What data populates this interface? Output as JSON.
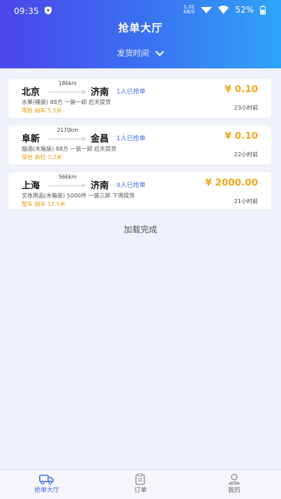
{
  "status_bar": {
    "time": "09:35",
    "net_speed_value": "1.02",
    "net_speed_unit": "KB/S",
    "battery": "52%"
  },
  "header": {
    "title": "抢单大厅",
    "filter_label": "发货时间"
  },
  "orders": [
    {
      "from": "北京",
      "to": "济南",
      "distance": "186km",
      "grabbed": "1人已抢单",
      "price": "¥ 0.10",
      "goods": "水果(桶装) 88方 一装一卸 后天提货",
      "vehicle": "零担 厢车 5.5米",
      "time_ago": "23小时前"
    },
    {
      "from": "阜新",
      "to": "金昌",
      "distance": "2170km",
      "grabbed": "1人已抢单",
      "price": "¥ 0.10",
      "goods": "烟酒(木箱装) 88方 一装一卸 后天提货",
      "vehicle": "零担 高栏 7.2米",
      "time_ago": "22小时前"
    },
    {
      "from": "上海",
      "to": "济南",
      "distance": "566km",
      "grabbed": "0人已抢单",
      "price": "¥ 2000.00",
      "goods": "文体用品(木箱装) 5000件 一装三卸 下周提货",
      "vehicle": "整车 厢车 17.5米",
      "time_ago": "21小时前"
    }
  ],
  "load_status": "加载完成",
  "tabs": [
    {
      "label": "抢单大厅",
      "icon": "truck-icon",
      "active": true
    },
    {
      "label": "订单",
      "icon": "clipboard-icon",
      "active": false
    },
    {
      "label": "我的",
      "icon": "user-icon",
      "active": false
    }
  ],
  "colors": {
    "accent": "#3e6df0",
    "price": "#f0a81a",
    "header_start": "#4b47ea",
    "header_end": "#2fa4f7"
  }
}
